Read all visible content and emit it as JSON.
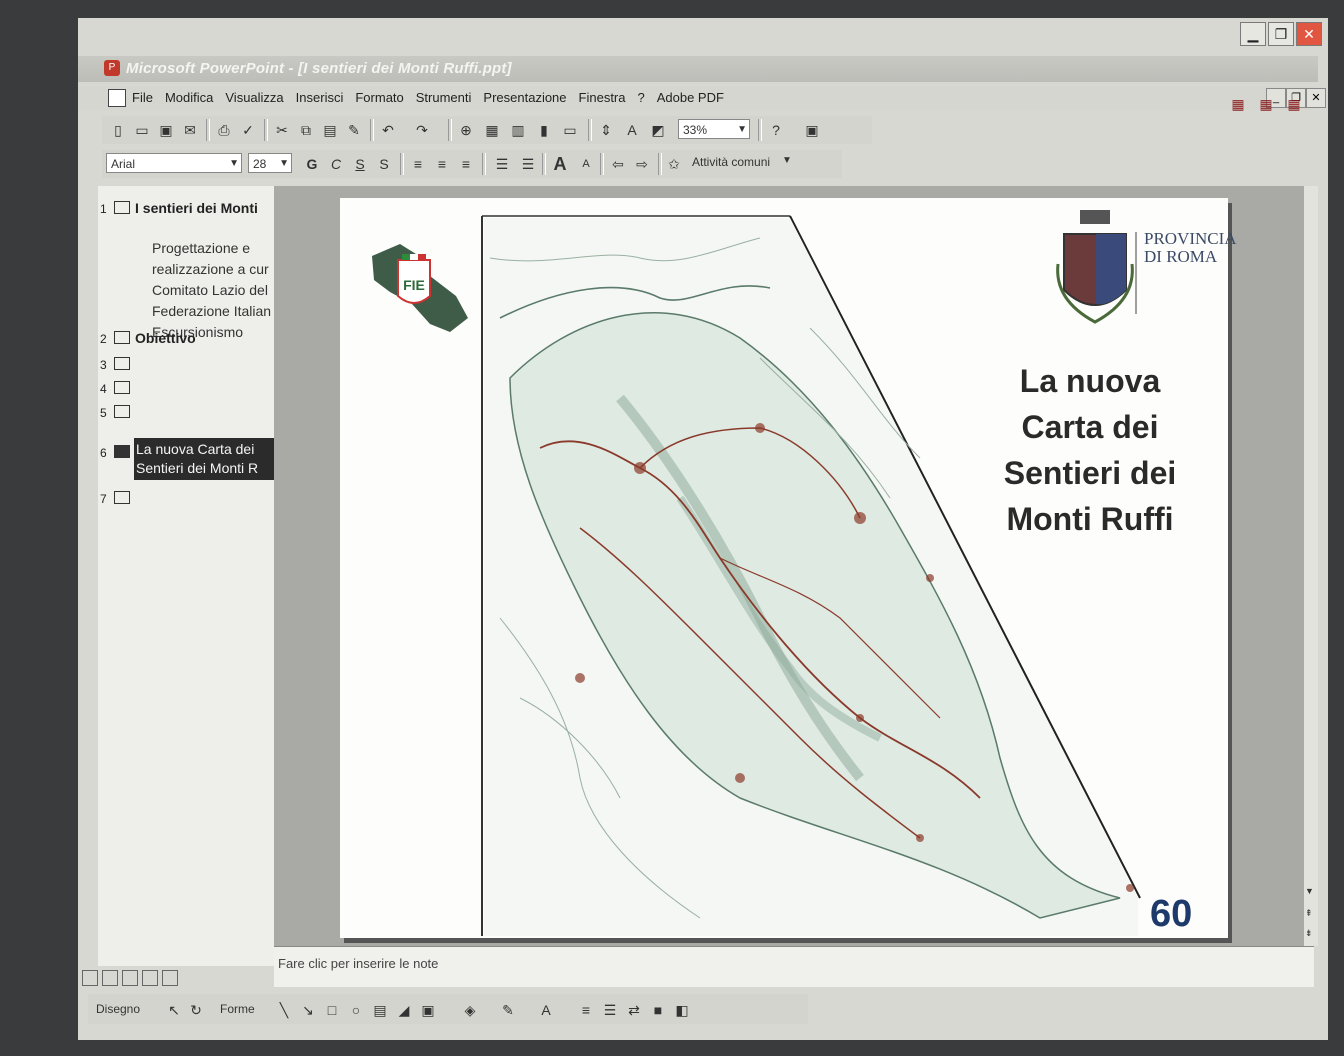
{
  "window": {
    "title": "Microsoft PowerPoint - [I sentieri dei Monti Ruffi.ppt]",
    "min_glyph": "▁",
    "max_glyph": "❐",
    "close_glyph": "✕"
  },
  "menu": {
    "items": [
      "File",
      "Modifica",
      "Visualizza",
      "Inserisci",
      "Formato",
      "Strumenti",
      "Presentazione",
      "Finestra",
      "?",
      "Adobe PDF"
    ]
  },
  "toolbar": {
    "zoom": "33%",
    "font": "Arial",
    "size": "28",
    "bold": "G",
    "italic": "C",
    "underline": "S",
    "shadow": "S",
    "common_tasks": "Attività comuni"
  },
  "outline": {
    "slides": [
      {
        "num": "1",
        "title": "I sentieri dei Monti"
      },
      {
        "num": "2",
        "title": "Obiettivo"
      },
      {
        "num": "3",
        "title": ""
      },
      {
        "num": "4",
        "title": ""
      },
      {
        "num": "5",
        "title": ""
      },
      {
        "num": "6",
        "title": "La nuova Carta dei Sentieri dei Monti R"
      },
      {
        "num": "7",
        "title": ""
      }
    ],
    "slide1_body": [
      "Progettazione e",
      "realizzazione a cur",
      "Comitato Lazio del",
      "Federazione Italian",
      "Escursionismo"
    ],
    "selected_line1": "La nuova Carta dei",
    "selected_line2": "Sentieri dei Monti R"
  },
  "slide": {
    "title_lines": [
      "La nuova",
      "Carta dei",
      "Sentieri dei",
      "Monti Ruffi"
    ],
    "provincia_line1": "PROVINCIA",
    "provincia_line2": "DI ROMA",
    "fie_logo_text": "FIE",
    "logo_60": "60"
  },
  "notes": {
    "placeholder": "Fare clic per inserire le note"
  },
  "drawing": {
    "draw_label": "Disegno",
    "shapes_label": "Forme"
  },
  "colors": {
    "map_line": "#5a7a6a",
    "trail": "#8a3a2a",
    "map_fill": "#dfeae3"
  }
}
